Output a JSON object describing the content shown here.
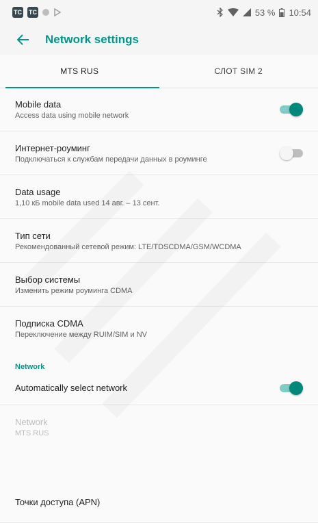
{
  "status_bar": {
    "left_icons": [
      "TC",
      "TC"
    ],
    "battery_text": "53 %",
    "time": "10:54"
  },
  "app_bar": {
    "title": "Network settings"
  },
  "tabs": [
    {
      "label": "MTS RUS",
      "active": true
    },
    {
      "label": "СЛОТ SIM 2",
      "active": false
    }
  ],
  "items": [
    {
      "title": "Mobile data",
      "summary": "Access data using mobile network",
      "switch": "on"
    },
    {
      "title": "Интернет-роуминг",
      "summary": "Подключаться к службам передачи данных в роуминге",
      "switch": "off"
    },
    {
      "title": "Data usage",
      "summary": "1,10 кБ mobile data used 14 авг. – 13 сент."
    },
    {
      "title": "Тип сети",
      "summary": "Рекомендованный сетевой режим: LTE/TDSCDMA/GSM/WCDMA"
    },
    {
      "title": "Выбор системы",
      "summary": "Изменить режим роуминга CDMA"
    },
    {
      "title": "Подписка CDMA",
      "summary": "Переключение между RUIM/SIM и NV"
    }
  ],
  "network_section": {
    "header": "Network",
    "auto_select": {
      "title": "Automatically select network",
      "switch": "on"
    },
    "network_item": {
      "title": "Network",
      "summary": "MTS RUS"
    },
    "apn_item": {
      "title": "Точки доступа (APN)"
    }
  },
  "colors": {
    "accent": "#009688",
    "switch_on": "#00897b"
  }
}
